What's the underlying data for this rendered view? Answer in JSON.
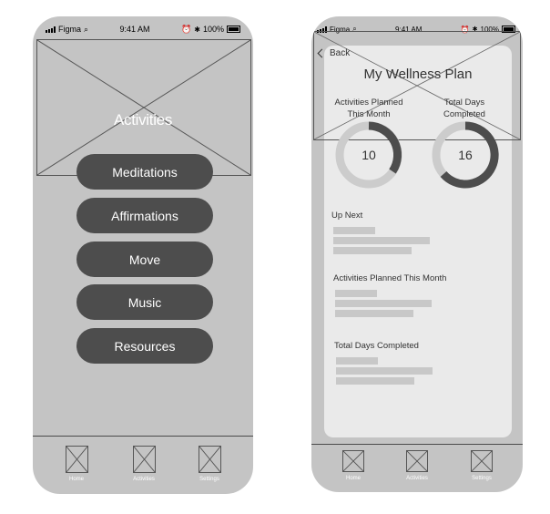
{
  "status": {
    "carrier": "Figma",
    "time": "9:41 AM",
    "battery": "100%"
  },
  "screen1": {
    "hero_title": "Activities",
    "menu": [
      {
        "label": "Meditations"
      },
      {
        "label": "Affirmations"
      },
      {
        "label": "Move"
      },
      {
        "label": "Music"
      },
      {
        "label": "Resources"
      }
    ]
  },
  "screen2": {
    "back_label": "Back",
    "title": "My Wellness Plan",
    "stat_planned_label_1": "Activities Planned",
    "stat_planned_label_2": "This Month",
    "stat_planned_value": "10",
    "stat_total_label_1": "Total Days",
    "stat_total_label_2": "Completed",
    "stat_total_value": "16",
    "sections": [
      {
        "title": "Up Next"
      },
      {
        "title": "Activities Planned This Month"
      },
      {
        "title": "Total Days Completed"
      }
    ]
  },
  "tabs": [
    {
      "label": "Home",
      "icon": "placeholder-image-icon"
    },
    {
      "label": "Activities",
      "icon": "placeholder-image-icon"
    },
    {
      "label": "Settings",
      "icon": "placeholder-image-icon"
    }
  ],
  "colors": {
    "phone_bg": "#c4c4c4",
    "button_bg": "#4d4d4d",
    "card_bg": "#eaeaea",
    "ring_track": "#cccccc",
    "ring_fill": "#4d4d4d"
  }
}
